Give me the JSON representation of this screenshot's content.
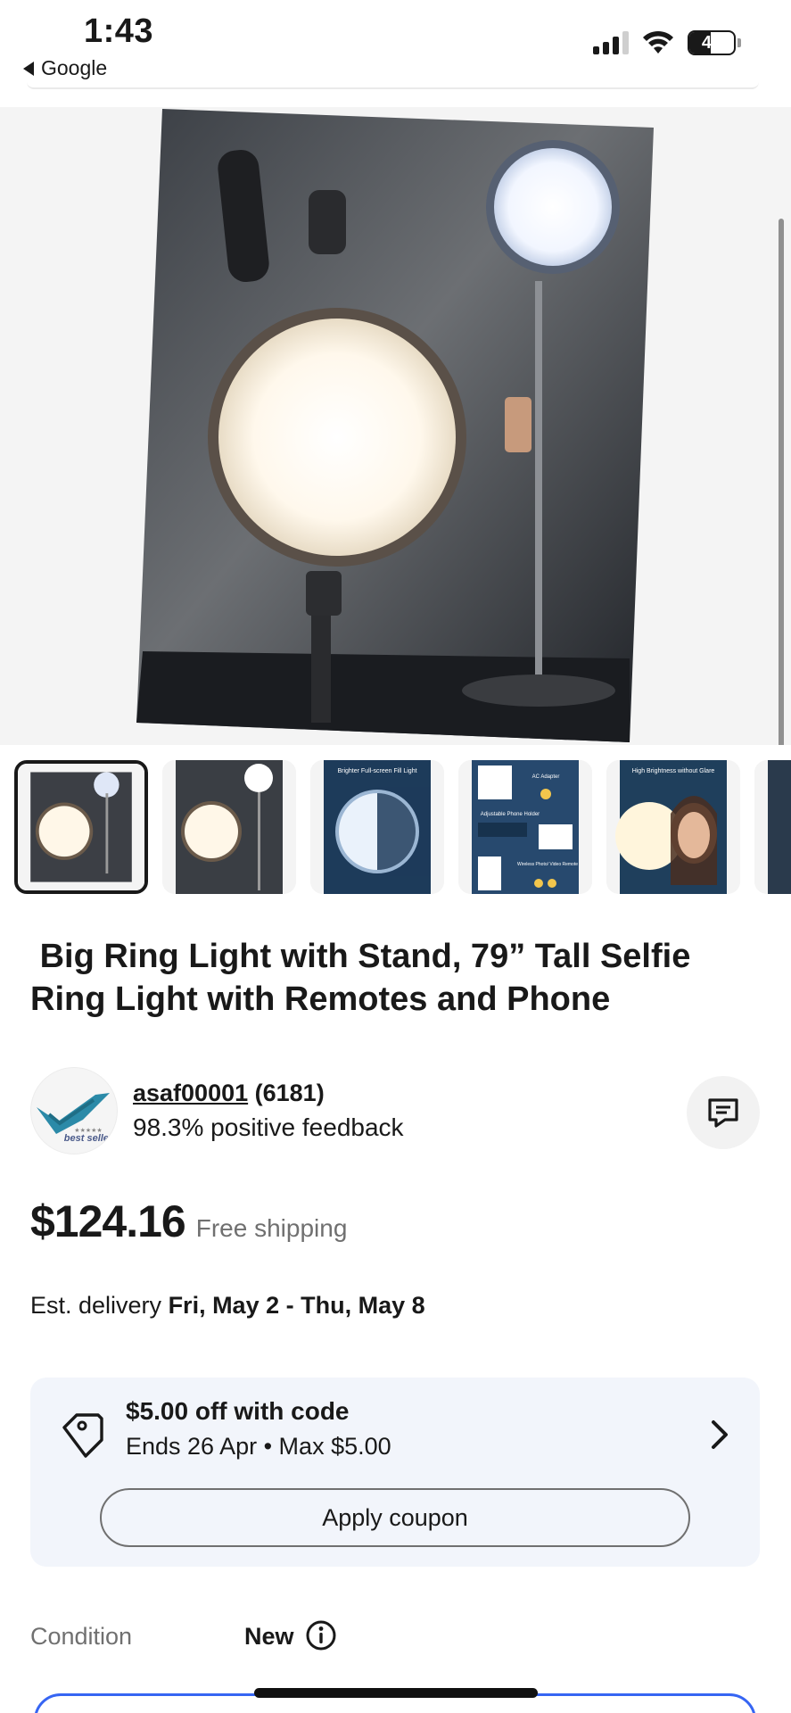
{
  "status_bar": {
    "time": "1:43",
    "back_app": "Google",
    "battery": "47"
  },
  "gallery": {
    "image_alt": "Big ring light with stand product photo",
    "thumbnails": [
      {
        "label": "",
        "selected": true
      },
      {
        "label": "",
        "selected": false
      },
      {
        "label": "Brighter Full-screen Fill Light",
        "selected": false
      },
      {
        "label": "AC Adapter",
        "sub": "Adjustable Phone Holder",
        "sub2": "Wireless Photo/ Video Remote",
        "selected": false
      },
      {
        "label": "High Brightness without Glare",
        "selected": false
      }
    ]
  },
  "product": {
    "title": " Big Ring Light with Stand, 79” Tall Selfie\nRing Light with Remotes and Phone"
  },
  "seller": {
    "avatar_text": "best seller",
    "name": "asaf00001",
    "count": "(6181)",
    "feedback": "98.3% positive feedback"
  },
  "price": {
    "amount": "$124.16",
    "shipping": "Free shipping"
  },
  "delivery": {
    "prefix": "Est. delivery ",
    "dates": "Fri, May 2 - Thu, May 8"
  },
  "coupon": {
    "title": "$5.00 off with code",
    "subtitle": "Ends 26 Apr • Max $5.00",
    "button": "Apply coupon"
  },
  "condition": {
    "label": "Condition",
    "value": "New"
  },
  "colors": {
    "text": "#191919",
    "muted": "#707070",
    "coupon_bg": "#f2f5fb",
    "accent": "#3665f3"
  },
  "icons": {
    "favorite": "heart-icon",
    "message": "message-icon",
    "coupon": "tag-icon",
    "chevron": "chevron-right-icon",
    "info": "info-icon"
  }
}
